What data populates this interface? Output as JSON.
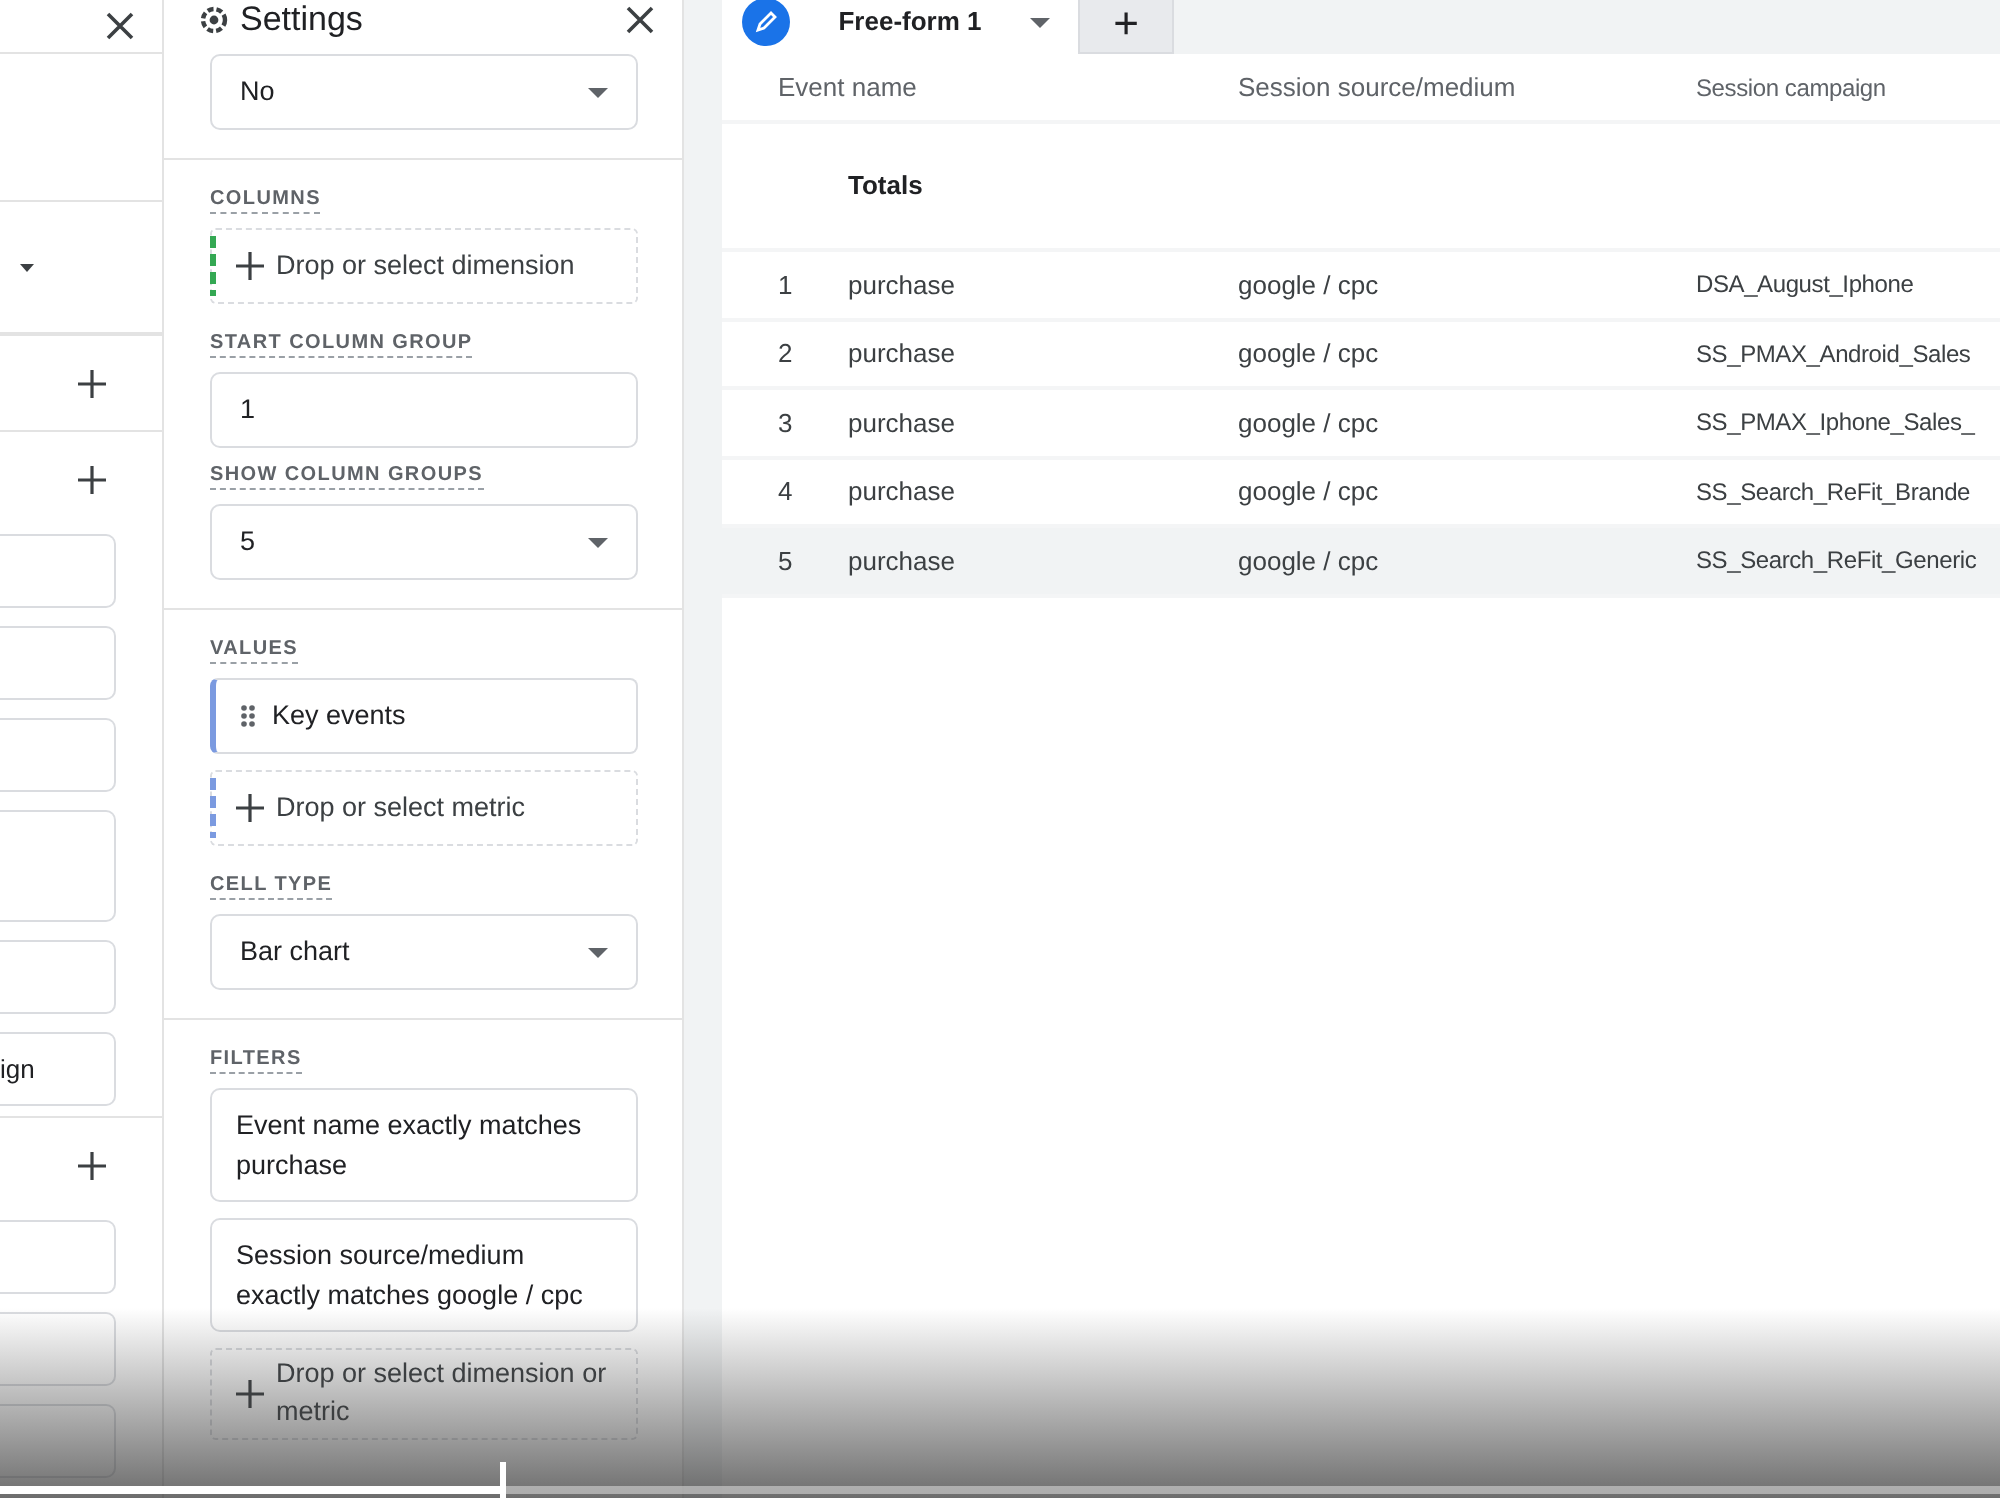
{
  "left_panel": {
    "items": [
      {
        "kind": "divider"
      },
      {
        "kind": "dropdown"
      },
      {
        "kind": "add"
      },
      {
        "kind": "add"
      },
      {
        "kind": "field"
      },
      {
        "kind": "field"
      },
      {
        "kind": "field"
      },
      {
        "kind": "tall_field"
      },
      {
        "kind": "field"
      },
      {
        "kind": "field",
        "value": "ign"
      },
      {
        "kind": "add"
      },
      {
        "kind": "field"
      },
      {
        "kind": "field"
      },
      {
        "kind": "field"
      }
    ]
  },
  "settings": {
    "title": "Settings",
    "blocks": [
      {
        "kind": "select",
        "value": "No"
      },
      {
        "kind": "divider"
      },
      {
        "kind": "label",
        "text": "COLUMNS"
      },
      {
        "kind": "drop",
        "text": "Drop or select dimension",
        "color": "#34a853"
      },
      {
        "kind": "label",
        "text": "START COLUMN GROUP"
      },
      {
        "kind": "input",
        "value": "1"
      },
      {
        "kind": "label",
        "text": "SHOW COLUMN GROUPS"
      },
      {
        "kind": "select",
        "value": "5"
      },
      {
        "kind": "divider"
      },
      {
        "kind": "label",
        "text": "VALUES"
      },
      {
        "kind": "chip",
        "text": "Key events",
        "color": "#7b9ae0"
      },
      {
        "kind": "drop",
        "text": "Drop or select metric",
        "color": "#7b9ae0"
      },
      {
        "kind": "label",
        "text": "CELL TYPE"
      },
      {
        "kind": "select",
        "value": "Bar chart"
      },
      {
        "kind": "divider"
      },
      {
        "kind": "label",
        "text": "FILTERS"
      },
      {
        "kind": "filter",
        "text": "Event name exactly matches purchase"
      },
      {
        "kind": "filter",
        "text": "Session source/medium exactly matches google / cpc"
      },
      {
        "kind": "drop",
        "text": "Drop or select dimension or metric"
      }
    ]
  },
  "tabs": [
    {
      "label": "Free-form 1",
      "selected": true
    },
    {
      "label": "+",
      "selected": false
    }
  ],
  "table": {
    "columns": [
      "Event name",
      "Session source/medium",
      "Session campaign"
    ],
    "totals_label": "Totals",
    "rows": [
      {
        "index": "1",
        "event": "purchase",
        "source": "google / cpc",
        "campaign": "DSA_August_Iphone",
        "highlighted": false
      },
      {
        "index": "2",
        "event": "purchase",
        "source": "google / cpc",
        "campaign": "SS_PMAX_Android_Sales",
        "highlighted": false
      },
      {
        "index": "3",
        "event": "purchase",
        "source": "google / cpc",
        "campaign": "SS_PMAX_Iphone_Sales_",
        "highlighted": false
      },
      {
        "index": "4",
        "event": "purchase",
        "source": "google / cpc",
        "campaign": "SS_Search_ReFit_Brande",
        "highlighted": false
      },
      {
        "index": "5",
        "event": "purchase",
        "source": "google / cpc",
        "campaign": "SS_Search_ReFit_Generic",
        "highlighted": true
      }
    ]
  },
  "video_player": {
    "level": 0.25
  }
}
